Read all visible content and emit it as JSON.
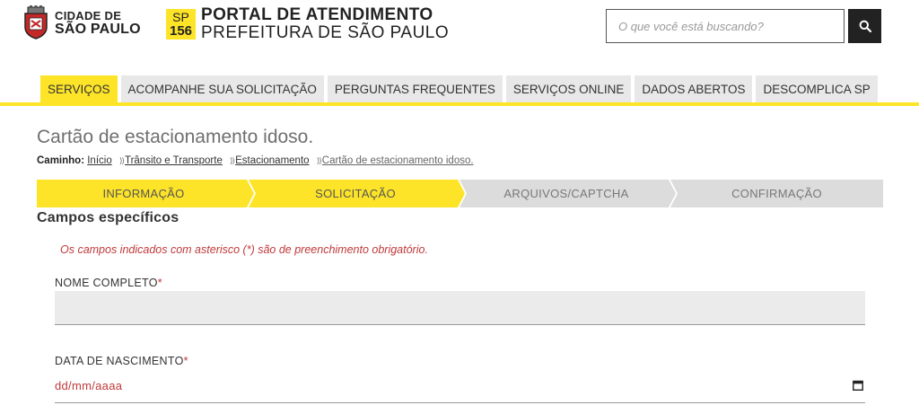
{
  "header": {
    "city_line1": "CIDADE DE",
    "city_line2": "SÃO PAULO",
    "badge_line1": "SP",
    "badge_line2": "156",
    "portal_line1": "PORTAL DE ATENDIMENTO",
    "portal_line2": "PREFEITURA DE SÃO PAULO",
    "search_placeholder": "O que você está buscando?",
    "search_icon": "search-icon"
  },
  "nav": {
    "items": [
      {
        "label": "SERVIÇOS",
        "active": true
      },
      {
        "label": "ACOMPANHE SUA SOLICITAÇÃO",
        "active": false
      },
      {
        "label": "PERGUNTAS FREQUENTES",
        "active": false
      },
      {
        "label": "SERVIÇOS ONLINE",
        "active": false
      },
      {
        "label": "DADOS ABERTOS",
        "active": false
      },
      {
        "label": "DESCOMPLICA SP",
        "active": false
      }
    ]
  },
  "page": {
    "title": "Cartão de estacionamento idoso.",
    "breadcrumb_label": "Caminho:",
    "breadcrumb": [
      "Início",
      "Trânsito e Transporte",
      "Estacionamento",
      "Cartão de estacionamento idoso."
    ],
    "breadcrumb_sep": "⟩⟩"
  },
  "steps": [
    {
      "label": "INFORMAÇÃO",
      "state": "done"
    },
    {
      "label": "SOLICITAÇÃO",
      "state": "active"
    },
    {
      "label": "ARQUIVOS/CAPTCHA",
      "state": "pending"
    },
    {
      "label": "CONFIRMAÇÃO",
      "state": "pending"
    }
  ],
  "form": {
    "section_title": "Campos específicos",
    "notice": "Os campos indicados com asterisco (*) são de preenchimento obrigatório.",
    "name_label": "NOME COMPLETO",
    "name_value": "",
    "birth_label": "DATA DE NASCIMENTO",
    "birth_placeholder": "dd/mm/aaaa",
    "required_mark": "*",
    "calendar_icon": "calendar-icon"
  },
  "colors": {
    "accent_yellow": "#fde428",
    "tab_gray": "#e8e8e8",
    "step_pending": "#dcdcdc",
    "required_red": "#c0393b",
    "dark": "#222222"
  }
}
